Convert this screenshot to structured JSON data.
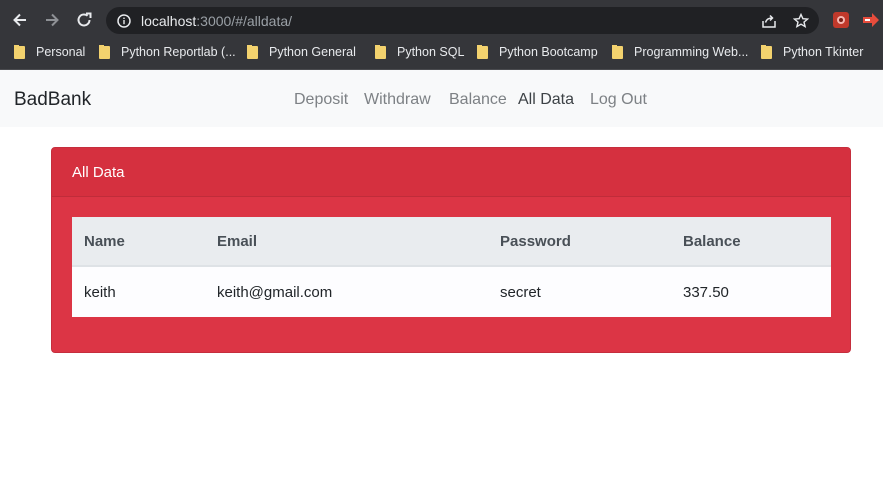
{
  "browser": {
    "url_host": "localhost",
    "url_rest": ":3000/#/alldata/",
    "icons": [
      "back-icon",
      "forward-icon",
      "reload-icon",
      "site-info-icon",
      "share-icon",
      "bookmark-star-icon",
      "extension-icon",
      "extension-icon-2"
    ],
    "bookmarks": [
      {
        "label": "Personal"
      },
      {
        "label": "Python Reportlab (..."
      },
      {
        "label": "Python General"
      },
      {
        "label": "Python SQL"
      },
      {
        "label": "Python Bootcamp"
      },
      {
        "label": "Programming Web..."
      },
      {
        "label": "Python Tkinter"
      }
    ]
  },
  "navbar": {
    "brand": "BadBank",
    "links": [
      {
        "label": "Deposit"
      },
      {
        "label": "Withdraw"
      },
      {
        "label": "Balance"
      },
      {
        "label": "All Data"
      },
      {
        "label": "Log Out"
      }
    ],
    "active": "All Data"
  },
  "card": {
    "title": "All Data",
    "color": "#dc3545",
    "table": {
      "headers": [
        "Name",
        "Email",
        "Password",
        "Balance"
      ],
      "rows": [
        [
          "keith",
          "keith@gmail.com",
          "secret",
          "337.50"
        ]
      ]
    }
  }
}
